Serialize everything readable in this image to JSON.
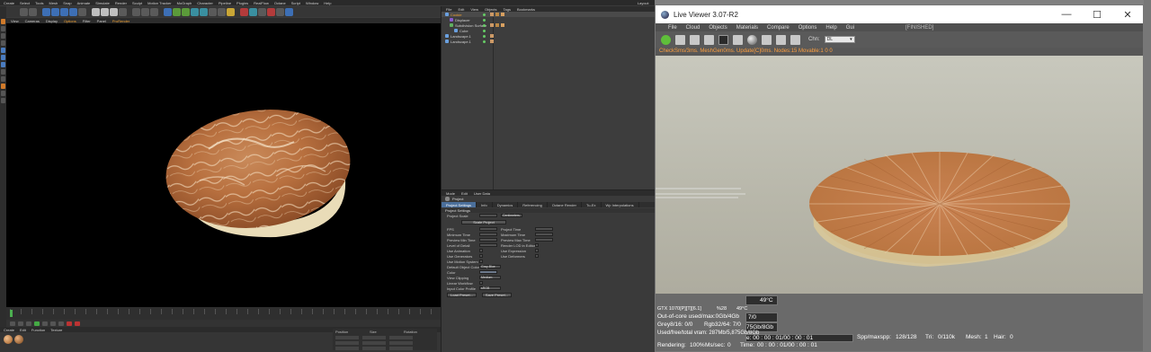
{
  "c4d": {
    "menu": [
      "Create",
      "Select",
      "Tools",
      "Mesh",
      "Snap",
      "Animate",
      "Simulate",
      "Render",
      "Sculpt",
      "Motion Tracker",
      "MoGraph",
      "Character",
      "Pipeline",
      "Plugins",
      "RealFlow",
      "Octane",
      "Script",
      "Window",
      "Help"
    ],
    "layout_label": "Layout:",
    "viewport_menu": [
      "View",
      "Cameras",
      "Display",
      "Options",
      "Filter",
      "Panel",
      "ProRender"
    ],
    "object_manager": {
      "menu": [
        "File",
        "Edit",
        "View",
        "Objects",
        "Tags",
        "Bookmarks"
      ],
      "objects": [
        {
          "name": "Cookie"
        },
        {
          "name": "Displacer"
        },
        {
          "name": "Subdivision Surface"
        },
        {
          "name": "Cube"
        },
        {
          "name": "Landscape.1"
        },
        {
          "name": "Landscape.1"
        }
      ]
    },
    "attribute_manager": {
      "menu": [
        "Mode",
        "Edit",
        "User Data"
      ],
      "title": "Project",
      "tabs": [
        "Project Settings",
        "Info",
        "Dynamics",
        "Referencing",
        "Octane Render",
        "Tu-Ex",
        "Wp Interpolations"
      ],
      "section": "Project Settings",
      "rows": [
        {
          "label": "Project Scale"
        },
        {
          "label": "FPS",
          "label2": "Project Time"
        },
        {
          "label": "Minimum Time",
          "label2": "Maximum Time"
        },
        {
          "label": "Preview Min Time",
          "label2": "Preview Max Time"
        },
        {
          "label": "Level of Detail",
          "label2": "Render LOD in Editor"
        },
        {
          "label": "Use Animation",
          "label2": "Use Expression"
        },
        {
          "label": "Use Generators",
          "label2": "Use Deformers"
        },
        {
          "label": "Use Motion System"
        },
        {
          "label": "Default Object Color"
        },
        {
          "label": "Color"
        },
        {
          "label": "View Clipping"
        },
        {
          "label": "Linear Workflow"
        },
        {
          "label": "Input Color Profile"
        }
      ],
      "buttons": [
        "Scale Project",
        "Load Preset...",
        "Save Preset..."
      ],
      "project_scale_unit": "Centimeters",
      "default_color": "Gray-Blue",
      "view_clipping": "Medium",
      "color_profile": "sRGB"
    },
    "bottom_tabs": [
      "Create",
      "Edit",
      "Function",
      "Texture"
    ],
    "coord_headers": [
      "Position",
      "Size",
      "Rotation"
    ]
  },
  "live_viewer": {
    "title": "Live Viewer 3.07-R2",
    "window_buttons": [
      "—",
      "☐",
      "✕"
    ],
    "menu": [
      "File",
      "Cloud",
      "Objects",
      "Materials",
      "Compare",
      "Options",
      "Help",
      "Gui"
    ],
    "state": "[FINISHED]",
    "channel_label": "Chn:",
    "channel_value": "DL",
    "status_line": "CheckSms/3ms. MeshGen0ms. Update[C]0ms. Nodes:15 Movable:1  0 0",
    "gpu": "GTX 1070[P][T][6.1]",
    "gpu_pct": "%28",
    "gpu_temp": "49°C",
    "temp_box": "49°C",
    "ooc_label": "Out-of-core used/max:0Gb/4Gb",
    "ooc_val": "7/0",
    "grey_label": "Grey8/16: 0/0",
    "rgb_label": "Rgb32/64: 7/0",
    "vram_label": "Used/free/total vram: 287Mb/5,875Gb/8Gb",
    "vram_box": "75Gb/8Gb",
    "rendering_label": "Rendering:",
    "rendering_val": "100%",
    "ms_label": "Ms/sec:",
    "ms_val": "0",
    "time_label": "Time:",
    "time_val": "00 : 00 : 01/00 : 00 : 01",
    "timer_box": "e: 00 : 00 : 01/00 : 00 : 01",
    "spp_label": "Spp/maxspp:",
    "spp_val": "128/128",
    "tri_label": "Tri:",
    "tri_val": "0/110k",
    "mesh_label": "Mesh:",
    "mesh_val": "1",
    "hair_label": "Hair:",
    "hair_val": "0"
  }
}
